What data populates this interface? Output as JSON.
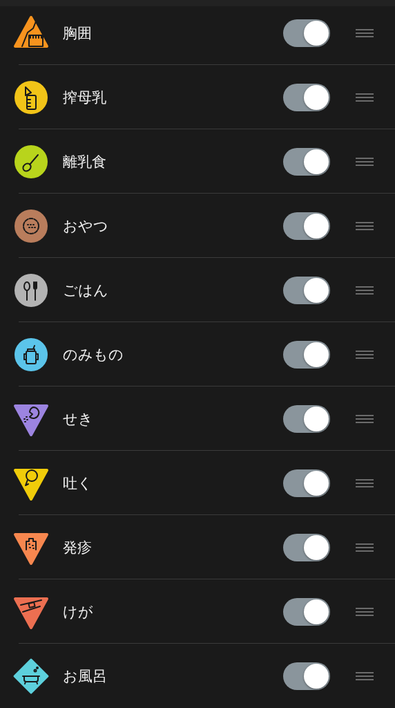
{
  "items": [
    {
      "label": "胸囲",
      "kind": "triangle",
      "color": "#f7931e",
      "on": true
    },
    {
      "label": "搾母乳",
      "kind": "circle",
      "color": "#f2c418",
      "on": true
    },
    {
      "label": "離乳食",
      "kind": "circle",
      "color": "#b8d41c",
      "on": true
    },
    {
      "label": "おやつ",
      "kind": "circle",
      "color": "#b97d5c",
      "on": true
    },
    {
      "label": "ごはん",
      "kind": "circle",
      "color": "#b3b3b3",
      "on": true
    },
    {
      "label": "のみもの",
      "kind": "circle",
      "color": "#5bc4ea",
      "on": true
    },
    {
      "label": "せき",
      "kind": "down-triangle",
      "color": "#9c84e0",
      "on": true
    },
    {
      "label": "吐く",
      "kind": "down-triangle",
      "color": "#f0cc0a",
      "on": true
    },
    {
      "label": "発疹",
      "kind": "down-triangle",
      "color": "#f7874f",
      "on": true
    },
    {
      "label": "けが",
      "kind": "down-triangle",
      "color": "#ec6f51",
      "on": true
    },
    {
      "label": "お風呂",
      "kind": "diamond",
      "color": "#5dd0dc",
      "on": true
    }
  ]
}
